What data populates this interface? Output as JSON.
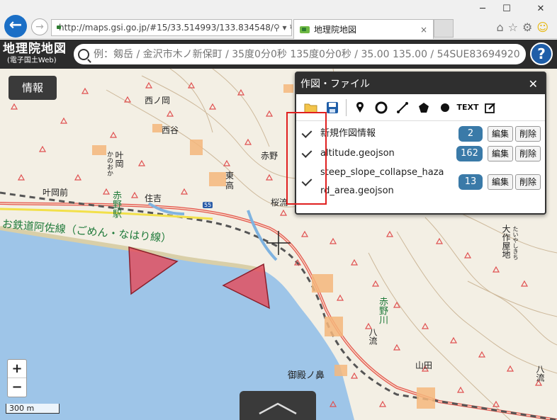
{
  "browser": {
    "url": "http://maps.gsi.go.jp/#15/33.514993/133.834548/",
    "tab_title": "地理院地図",
    "tab_close": "×",
    "back_glyph": "←",
    "forward_glyph": "→",
    "minimize": "─",
    "maximize": "☐",
    "close": "✕",
    "search_addr_glyph": "⚲ ▾ ↻",
    "tools": {
      "home": "⌂",
      "star": "☆",
      "gear": "⚙",
      "smile": "☺"
    }
  },
  "header": {
    "logo_main": "地理院地図",
    "logo_sub": "(電子国土Web)",
    "search_placeholder": "例：剱岳 / 金沢市木ノ新保町 / 35度0分0秒 135度0分0秒 / 35.00 135.00 / 54SUE83694920",
    "help": "?"
  },
  "map": {
    "info_button": "情報",
    "zoom_in": "+",
    "zoom_out": "−",
    "scale": "300 m",
    "labels": {
      "nishioka": "西ノ岡",
      "nishiguchi": "西谷",
      "kanouka": "かのおか",
      "kanouka_kanji": "叶岡",
      "akano": "赤野",
      "akano_station": "赤野駅",
      "higashi": "東",
      "higashi2": "高",
      "kanoka_mae": "叶岡前",
      "sumiyoshi": "住吉",
      "sakuranagare": "桜流",
      "railway": "お鉄道阿佐線（ごめん・なはり線）",
      "route_shield": "55",
      "daisaku": "大作屋地",
      "daisaku_kana": "たいやしきち",
      "akano_river": "赤野川",
      "ryu": "八流",
      "yamada": "山田",
      "mitono_hana": "御殿ノ鼻",
      "hachiryu": "八流"
    }
  },
  "panel": {
    "title": "作図・ファイル",
    "close": "✕",
    "tools": [
      "open-folder",
      "save",
      "marker",
      "circle",
      "line",
      "polygon",
      "dot",
      "TEXT",
      "edit"
    ],
    "text_tool": "TEXT",
    "layers": [
      {
        "name": "新規作図情報",
        "count": "2",
        "edit": "編集",
        "delete": "削除"
      },
      {
        "name": "altitude.geojson",
        "count": "162",
        "edit": "編集",
        "delete": "削除"
      },
      {
        "name": "steep_slope_collapse_hazard_area.geojson",
        "name_line1": "steep_slope_collapse_haza",
        "name_line2": "rd_area.geojson",
        "count": "13",
        "edit": "編集",
        "delete": "削除"
      }
    ]
  },
  "colors": {
    "chrome": "#f0f0f0",
    "header": "#2c2c2c",
    "sea": "#9ec5e8",
    "land": "#f3efe4",
    "accent_blue": "#3a7aa8",
    "hazard_red": "#e05060",
    "highlight_red": "#e02020"
  }
}
